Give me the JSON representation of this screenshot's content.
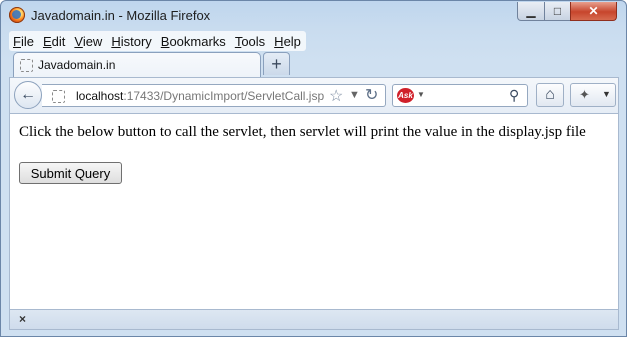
{
  "window": {
    "title": "Javadomain.in - Mozilla Firefox",
    "controls": {
      "minimize": "▁",
      "maximize": "□",
      "close": "✕"
    }
  },
  "menu": [
    {
      "accel": "F",
      "rest": "ile"
    },
    {
      "accel": "E",
      "rest": "dit"
    },
    {
      "accel": "V",
      "rest": "iew"
    },
    {
      "accel": "H",
      "rest": "istory"
    },
    {
      "accel": "B",
      "rest": "ookmarks"
    },
    {
      "accel": "T",
      "rest": "ools"
    },
    {
      "accel": "H",
      "rest": "elp"
    }
  ],
  "tabs": [
    {
      "label": "Javadomain.in"
    }
  ],
  "new_tab_label": "+",
  "urlbar": {
    "host": "localhost",
    "path": ":17433/DynamicImport/ServletCall.jsp"
  },
  "icons": {
    "back": "←",
    "star": "☆",
    "dropdown": "▼",
    "reload": "↻",
    "search": "⚲",
    "home": "⌂",
    "addon": "✦",
    "addon_dropdown": "▼",
    "ask_logo": "Ask",
    "close_addonbar": "×"
  },
  "page": {
    "instruction": "Click the below button to call the servlet, then servlet will print the value in the display.jsp file",
    "submit_label": "Submit Query"
  }
}
